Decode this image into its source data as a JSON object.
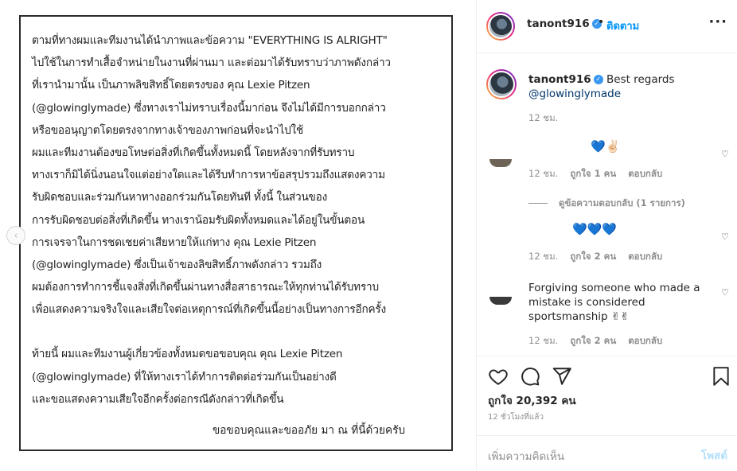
{
  "statement": {
    "lines": [
      "      ตามที่ทางผมและทีมงานได้นำภาพและข้อความ \"EVERYTHING IS ALRIGHT\"",
      " ไปใช้ในการทำเสื้อจำหน่ายในงานที่ผ่านมา และต่อมาได้รับทราบว่าภาพดังกล่าว",
      "ที่เรานำมานั้น เป็นภาพลิขสิทธิ์โดยตรงของ คุณ Lexie Pitzen",
      "(@glowinglymade) ซึ่งทางเราไม่ทราบเรื่องนี้มาก่อน จึงไม่ได้มีการบอกกล่าว",
      "หรือขออนุญาตโดยตรงจากทางเจ้าของภาพก่อนที่จะนำไปใช้",
      "      ผมและทีมงานต้องขอโทษต่อสิ่งที่เกิดขึ้นทั้งหมดนี้ โดยหลังจากที่รับทราบ",
      "ทางเราก็มิได้นิ่งนอนใจแต่อย่างใดและได้รีบทำการหาข้อสรุปรวมถึงแสดงความ",
      "รับผิดชอบและร่วมกันหาทางออกร่วมกันโดยทันที   ทั้งนี้ ในส่วนของ",
      "การรับผิดชอบต่อสิ่งที่เกิดขึ้น ทางเราน้อมรับผิดทั้งหมดและได้อยู่ในขั้นตอน",
      "การเจรจาในการชดเชยค่าเสียหายให้แก่ทาง คุณ Lexie Pitzen",
      "(@glowinglymade) ซึ่งเป็นเจ้าของลิขสิทธิ์ภาพดังกล่าว รวมถึง",
      "ผมต้องการทำการชี้แจงสิ่งที่เกิดขึ้นผ่านทางสื่อสาธารณะให้ทุกท่านได้รับทราบ",
      "เพื่อแสดงความจริงใจและเสียใจต่อเหตุการณ์ที่เกิดขึ้นนี้อย่างเป็นทางการอีกครั้ง",
      "",
      "      ท้ายนี้ ผมและทีมงานผู้เกี่ยวข้องทั้งหมดขอขอบคุณ คุณ Lexie Pitzen",
      "(@glowinglymade) ที่ให้ทางเราได้ทำการติดต่อร่วมกันเป็นอย่างดี",
      "และขอแสดงความเสียใจอีกครั้งต่อกรณีดังกล่าวที่เกิดขึ้น"
    ],
    "signature": "ขอขอบคุณและขออภัย มา ณ ที่นี้ด้วยครับ"
  },
  "header": {
    "username": "tanont916",
    "verified_glyph": "✓",
    "separator": "•",
    "follow_label": "ติดตาม",
    "more_label": "···"
  },
  "caption": {
    "username": "tanont916",
    "text": "Best regards",
    "mention": "@glowinglymade",
    "time": "12 ชม."
  },
  "comments": [
    {
      "text": "💙✌🏻",
      "time": "12 ชม.",
      "likes": "ถูกใจ 1 คน",
      "reply": "ตอบกลับ"
    },
    {
      "text": "💙💙💙",
      "time": "12 ชม.",
      "likes": "ถูกใจ 2 คน",
      "reply": "ตอบกลับ"
    },
    {
      "text": "Forgiving someone who made a mistake is considered sportsmanship ✌✌",
      "time": "12 ชม.",
      "likes": "ถูกใจ 2 คน",
      "reply": "ตอบกลับ"
    }
  ],
  "view_replies": "ดูข้อความตอบกลับ (1 รายการ)",
  "like_count": "ถูกใจ 20,392 คน",
  "time_ago": "12 ชั่วโมงที่แล้ว",
  "add_comment": {
    "placeholder": "เพิ่มความคิดเห็น",
    "post_label": "โพสต์"
  },
  "nav": {
    "prev_glyph": "‹"
  },
  "heart_glyph": "♡",
  "colors": {
    "accent": "#0095f6",
    "verified": "#3897f0",
    "muted": "#8e8e8e",
    "post_disabled": "#b2dffc"
  }
}
